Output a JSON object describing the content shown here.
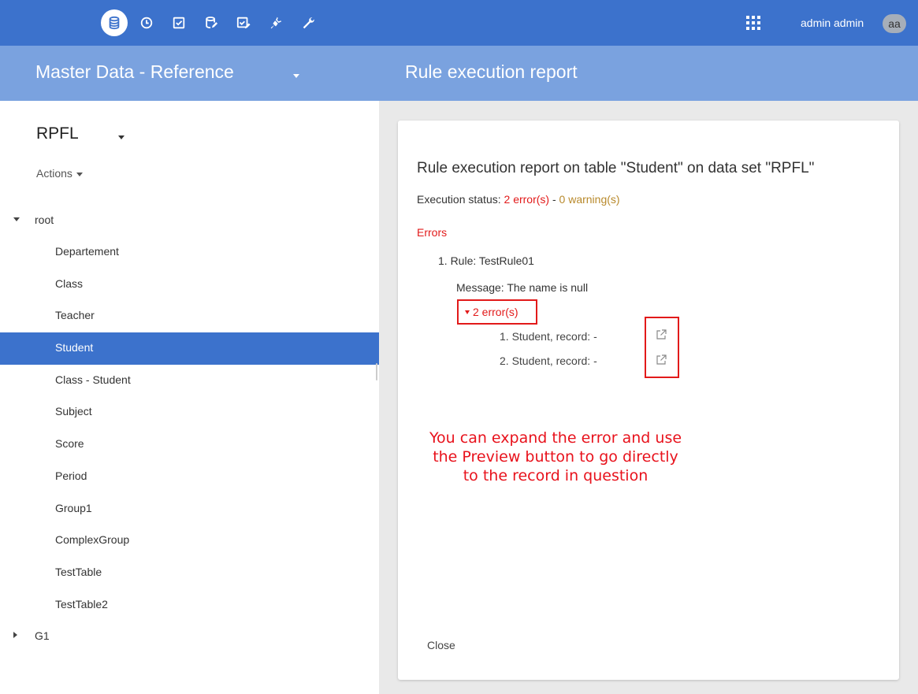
{
  "topbar": {
    "icons": [
      "database-icon",
      "clock-icon",
      "checkbox-icon",
      "database-edit-icon",
      "checkbox-edit-icon",
      "plug-icon",
      "wrench-icon"
    ],
    "apps_icon": "apps-grid-icon",
    "user_name": "admin admin",
    "avatar_initials": "aa",
    "accent_color": "#3c72cc"
  },
  "subheader": {
    "dataspace": "Master Data - Reference",
    "page_title": "Rule execution report",
    "color": "#7aa2df"
  },
  "sidebar": {
    "dataset": "RPFL",
    "actions_label": "Actions",
    "root_label": "root",
    "items": [
      {
        "label": "Departement"
      },
      {
        "label": "Class"
      },
      {
        "label": "Teacher"
      },
      {
        "label": "Student"
      },
      {
        "label": "Class - Student"
      },
      {
        "label": "Subject"
      },
      {
        "label": "Score"
      },
      {
        "label": "Period"
      },
      {
        "label": "Group1"
      },
      {
        "label": "ComplexGroup"
      },
      {
        "label": "TestTable"
      },
      {
        "label": "TestTable2"
      },
      {
        "label": "G1"
      }
    ],
    "selected_item": "Student"
  },
  "report": {
    "heading": "Rule execution report on table \"Student\" on data set \"RPFL\"",
    "status_prefix": "Execution status: ",
    "status_errors": "2 error(s)",
    "status_sep": " - ",
    "status_warnings": "0 warning(s)",
    "errors_title": "Errors",
    "rule_line": "1. Rule: TestRule01",
    "message_line": "Message: The name is null",
    "errors_toggle": "2 error(s)",
    "error_items": [
      {
        "label": "1.  Student, record:  -"
      },
      {
        "label": "2.  Student, record:  -"
      }
    ],
    "annotation": [
      "You can expand the error and use",
      "the Preview button to go directly",
      "to the record in question"
    ],
    "close_label": "Close",
    "error_color": "#e21a1a",
    "warning_color": "#b8892b"
  }
}
